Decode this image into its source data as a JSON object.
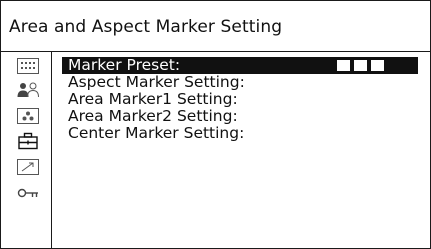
{
  "header": {
    "title": "Area and Aspect Marker Setting"
  },
  "sidebar": {
    "icons": [
      "grid-icon",
      "people-icon",
      "camera-icon",
      "toolbox-icon",
      "trend-arrow-icon",
      "key-icon"
    ]
  },
  "menu": {
    "items": [
      {
        "label": "Marker Preset:",
        "selected": true
      },
      {
        "label": "Aspect Marker Setting:",
        "selected": false
      },
      {
        "label": "Area Marker1 Setting:",
        "selected": false
      },
      {
        "label": "Area Marker2 Setting:",
        "selected": false
      },
      {
        "label": "Center Marker Setting:",
        "selected": false
      }
    ],
    "preset_value_blocks": 3
  },
  "colors": {
    "foreground": "#111111",
    "background": "#ffffff",
    "highlight": "#111111"
  }
}
